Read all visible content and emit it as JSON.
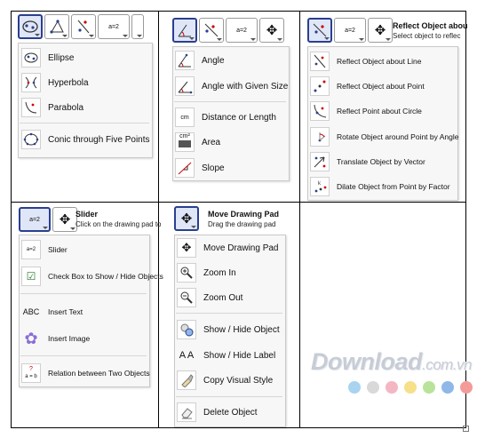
{
  "cell1": {
    "items": [
      {
        "label": "Ellipse",
        "icon": "ellipse-icon"
      },
      {
        "label": "Hyperbola",
        "icon": "hyperbola-icon"
      },
      {
        "label": "Parabola",
        "icon": "parabola-icon"
      },
      {
        "label": "Conic through Five Points",
        "icon": "conic-five-points-icon"
      }
    ],
    "toolbar_slider_text": "a=2"
  },
  "cell2": {
    "toolbar_slider_text": "a=2",
    "items": [
      {
        "label": "Angle",
        "icon": "angle-icon"
      },
      {
        "label": "Angle with Given Size",
        "icon": "angle-given-size-icon"
      },
      {
        "label": "Distance or Length",
        "icon": "distance-icon"
      },
      {
        "label": "Area",
        "icon": "area-icon"
      },
      {
        "label": "Slope",
        "icon": "slope-icon"
      }
    ],
    "distance_icon_text": "cm",
    "area_icon_text": "cm²"
  },
  "cell3": {
    "header_title": "Reflect Object abou",
    "header_sub": "Select object to reflec",
    "toolbar_slider_text": "a=2",
    "items": [
      {
        "label": "Reflect Object about Line",
        "icon": "reflect-line-icon"
      },
      {
        "label": "Reflect Object about Point",
        "icon": "reflect-point-icon"
      },
      {
        "label": "Reflect Point about Circle",
        "icon": "reflect-circle-icon"
      },
      {
        "label": "Rotate Object around Point by Angle",
        "icon": "rotate-icon"
      },
      {
        "label": "Translate Object by Vector",
        "icon": "translate-icon"
      },
      {
        "label": "Dilate Object from Point by Factor",
        "icon": "dilate-icon"
      }
    ]
  },
  "cell4": {
    "header_title": "Slider",
    "header_sub": "Click on the drawing pad to",
    "toolbar_slider_text": "a=2",
    "items": [
      {
        "label": "Slider",
        "icon": "slider-icon",
        "icon_text": "a=2"
      },
      {
        "label": "Check Box to Show / Hide Objects",
        "icon": "checkbox-icon"
      },
      {
        "label": "Insert Text",
        "icon": "text-icon",
        "icon_text": "ABC"
      },
      {
        "label": "Insert Image",
        "icon": "image-icon"
      },
      {
        "label": "Relation between Two Objects",
        "icon": "relation-icon",
        "icon_text": "a = b"
      }
    ],
    "relation_q": "?"
  },
  "cell5": {
    "header_title": "Move Drawing Pad",
    "header_sub": "Drag the drawing pad",
    "items": [
      {
        "label": "Move Drawing Pad",
        "icon": "move-pad-icon"
      },
      {
        "label": "Zoom In",
        "icon": "zoom-in-icon"
      },
      {
        "label": "Zoom Out",
        "icon": "zoom-out-icon"
      },
      {
        "label": "Show / Hide Object",
        "icon": "show-hide-object-icon"
      },
      {
        "label": "Show / Hide Label",
        "icon": "show-hide-label-icon",
        "icon_text": "A A"
      },
      {
        "label": "Copy Visual Style",
        "icon": "copy-style-icon"
      },
      {
        "label": "Delete Object",
        "icon": "delete-icon"
      }
    ]
  },
  "watermark": {
    "main": "Download",
    "domain": ".com.vn"
  },
  "colors": {
    "accent": "#2a3f8f",
    "dots": [
      "#a8d4f0",
      "#d9d9d9",
      "#f4b6c2",
      "#f7e08a",
      "#b9e39a",
      "#8fb8e8",
      "#f59a9a"
    ]
  }
}
